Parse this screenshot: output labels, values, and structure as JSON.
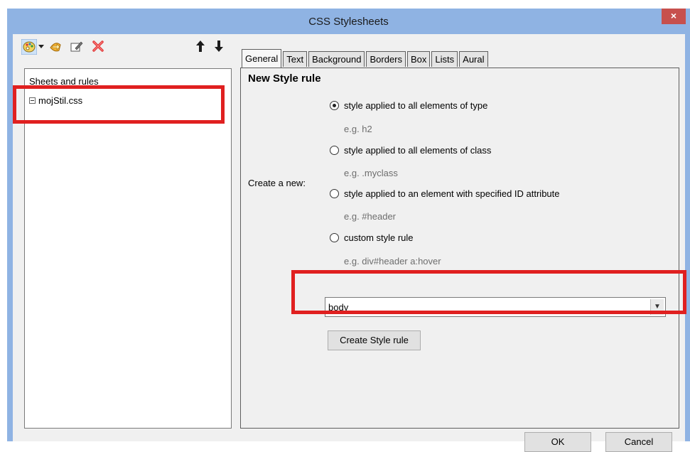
{
  "window": {
    "title": "CSS Stylesheets",
    "close_symbol": "×"
  },
  "toolbar": {
    "icons": [
      "palette-icon",
      "dropdown-arrow-icon",
      "import-icon",
      "edit-icon",
      "delete-icon",
      "move-up-icon",
      "move-down-icon"
    ]
  },
  "tree": {
    "header": "Sheets and rules",
    "items": [
      {
        "label": "mojStil.css",
        "expanded": true
      }
    ]
  },
  "tabs": [
    {
      "label": "General",
      "active": true
    },
    {
      "label": "Text"
    },
    {
      "label": "Background"
    },
    {
      "label": "Borders"
    },
    {
      "label": "Box"
    },
    {
      "label": "Lists"
    },
    {
      "label": "Aural"
    }
  ],
  "general": {
    "title": "New Style rule",
    "create_label": "Create a new:",
    "options": [
      {
        "label": "style applied to all elements of type",
        "example": "e.g. h2",
        "checked": true
      },
      {
        "label": "style applied to all elements of class",
        "example": "e.g. .myclass",
        "checked": false
      },
      {
        "label": "style applied to an element with specified ID attribute",
        "example": "e.g. #header",
        "checked": false
      },
      {
        "label": "custom style rule",
        "example": "e.g. div#header a:hover",
        "checked": false
      }
    ],
    "combo_value": "body",
    "create_button": "Create Style rule"
  },
  "footer": {
    "ok": "OK",
    "cancel": "Cancel"
  },
  "colors": {
    "frame": "#8fb3e3",
    "close": "#c7504d",
    "highlight": "#e02020"
  }
}
